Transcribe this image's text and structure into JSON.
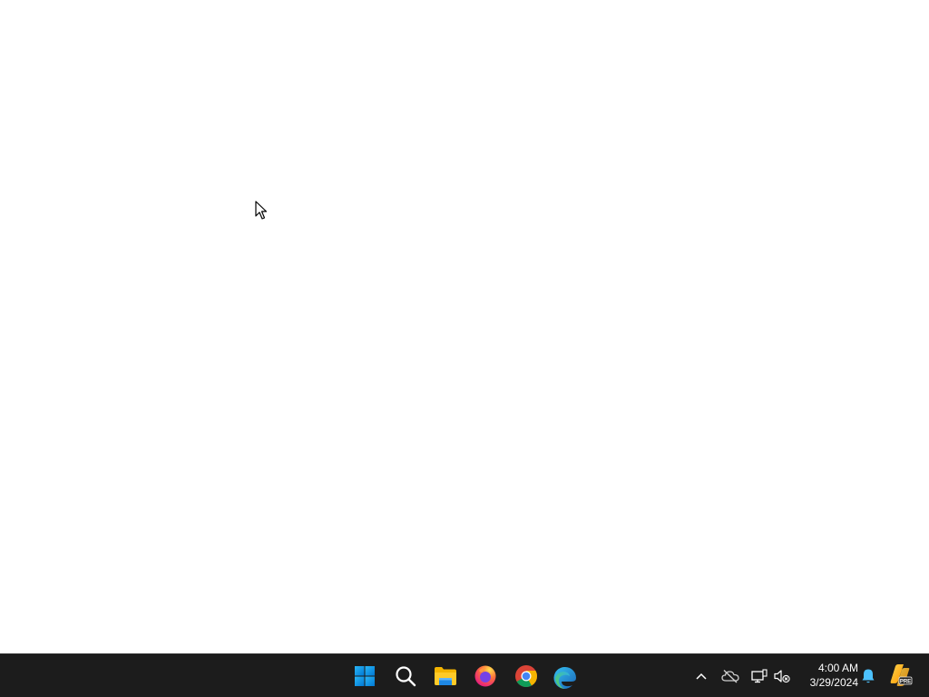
{
  "taskbar": {
    "pinned": [
      {
        "name": "Start",
        "icon": "windows-logo-icon"
      },
      {
        "name": "Search",
        "icon": "search-icon"
      },
      {
        "name": "File Explorer",
        "icon": "folder-icon"
      },
      {
        "name": "Firefox",
        "icon": "firefox-icon"
      },
      {
        "name": "Google Chrome",
        "icon": "chrome-icon"
      },
      {
        "name": "Microsoft Edge",
        "icon": "edge-icon"
      }
    ],
    "tray": {
      "icons": [
        "chevron-up-icon",
        "onedrive-offline-icon",
        "network-icon",
        "volume-muted-icon",
        "notification-bell-icon",
        "copilot-pre-icon"
      ],
      "copilot_badge": "PRE",
      "time": "4:00 AM",
      "date": "3/29/2024"
    }
  },
  "colors": {
    "taskbar_bg": "#1c1c1c",
    "desktop_bg": "#ffffff",
    "accent": "#0078d4"
  }
}
